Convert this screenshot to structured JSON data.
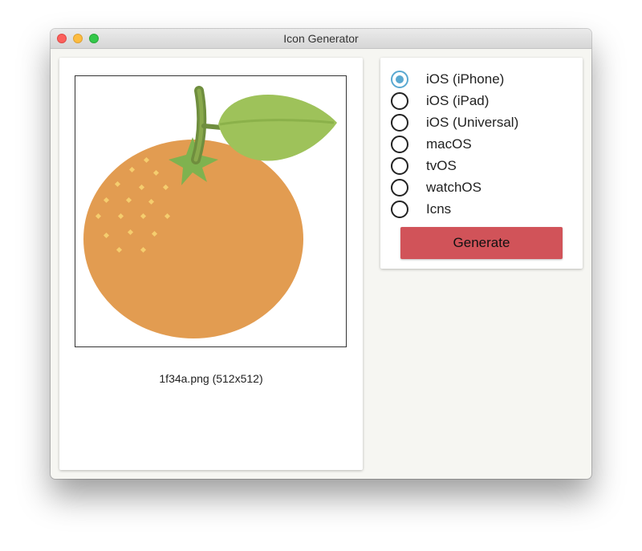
{
  "window": {
    "title": "Icon Generator"
  },
  "preview": {
    "file_caption": "1f34a.png (512x512)",
    "image_icon": "orange-fruit-icon"
  },
  "options": {
    "selected": "iOS (iPhone)",
    "items": [
      {
        "label": "iOS (iPhone)",
        "checked": true
      },
      {
        "label": "iOS (iPad)",
        "checked": false
      },
      {
        "label": "iOS (Universal)",
        "checked": false
      },
      {
        "label": "macOS",
        "checked": false
      },
      {
        "label": "tvOS",
        "checked": false
      },
      {
        "label": "watchOS",
        "checked": false
      },
      {
        "label": "Icns",
        "checked": false
      }
    ],
    "generate_label": "Generate"
  },
  "colors": {
    "accent_radio": "#5aa9d1",
    "generate_button": "#d15359",
    "orange_body": "#e29c51",
    "leaf": "#9ec25a"
  }
}
